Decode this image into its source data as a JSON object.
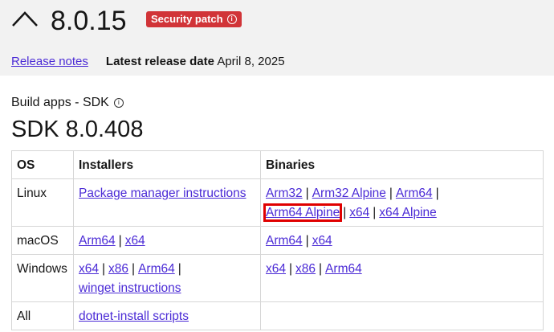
{
  "header": {
    "version": "8.0.15",
    "badge": "Security patch",
    "badge_info_glyph": "i",
    "release_notes_link": "Release notes",
    "latest_release_label": "Latest release date",
    "latest_release_date": "April 8, 2025"
  },
  "sdk": {
    "subtitle": "Build apps - SDK",
    "subtitle_info_glyph": "i",
    "title": "SDK 8.0.408"
  },
  "table": {
    "headers": [
      "OS",
      "Installers",
      "Binaries"
    ],
    "rows": [
      {
        "os": "Linux",
        "installers": [
          "Package manager instructions"
        ],
        "binaries": [
          "Arm32",
          "Arm32 Alpine",
          "Arm64",
          "Arm64 Alpine",
          "x64",
          "x64 Alpine"
        ]
      },
      {
        "os": "macOS",
        "installers": [
          "Arm64",
          "x64"
        ],
        "binaries": [
          "Arm64",
          "x64"
        ]
      },
      {
        "os": "Windows",
        "installers": [
          "x64",
          "x86",
          "Arm64",
          "winget instructions"
        ],
        "binaries": [
          "x64",
          "x86",
          "Arm64"
        ]
      },
      {
        "os": "All",
        "installers": [
          "dotnet-install scripts"
        ],
        "binaries": []
      }
    ],
    "separator": "|"
  },
  "colors": {
    "link": "#4b2bd6",
    "badge": "#d13438",
    "highlight": "#e00000",
    "header_bg": "#f2f2f2"
  }
}
